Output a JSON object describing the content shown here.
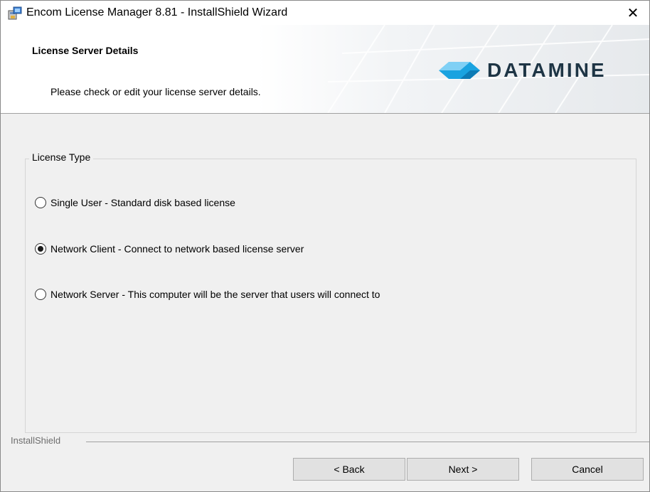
{
  "window": {
    "title": "Encom License Manager 8.81 - InstallShield Wizard",
    "close_glyph": "✕"
  },
  "banner": {
    "title": "License Server Details",
    "subtitle": "Please check or edit your license server details.",
    "logo_text": "DATAMINE",
    "logo_color": "#1e3545",
    "logo_accent": "#1aa3e0"
  },
  "license_type": {
    "label": "License Type",
    "options": [
      {
        "label": "Single User - Standard disk based license",
        "selected": false
      },
      {
        "label": "Network Client - Connect to network based license server",
        "selected": true
      },
      {
        "label": "Network Server - This computer will be the server that users will connect to",
        "selected": false
      }
    ]
  },
  "footer": {
    "brand": "InstallShield",
    "back_label": "< Back",
    "next_label": "Next >",
    "cancel_label": "Cancel"
  }
}
